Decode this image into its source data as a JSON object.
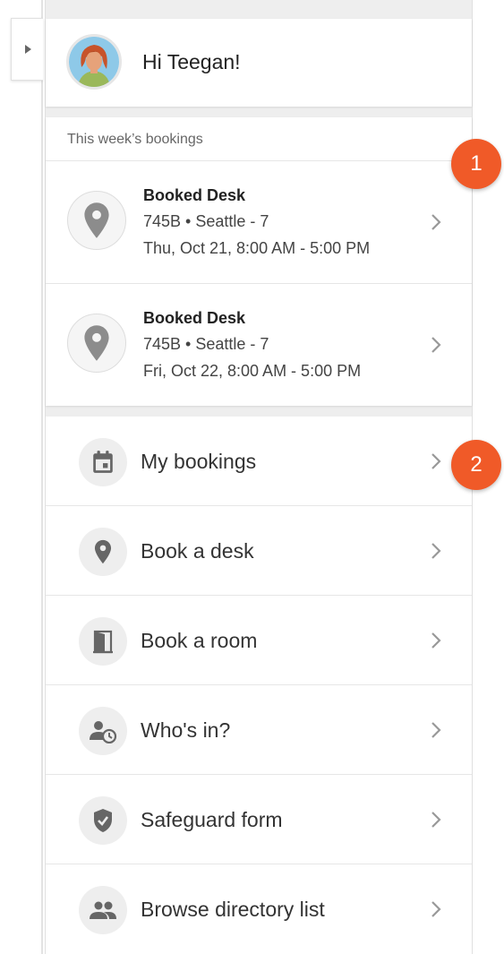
{
  "greeting": {
    "text": "Hi Teegan!"
  },
  "bookings": {
    "title": "This week’s bookings",
    "items": [
      {
        "title": "Booked Desk",
        "location": "745B • Seattle - 7",
        "time": "Thu, Oct 21, 8:00 AM - 5:00 PM",
        "icon": "location-pin-icon"
      },
      {
        "title": "Booked Desk",
        "location": "745B • Seattle - 7",
        "time": "Fri, Oct 22, 8:00 AM - 5:00 PM",
        "icon": "location-pin-icon"
      }
    ]
  },
  "menu": {
    "items": [
      {
        "label": "My bookings",
        "icon": "calendar-icon"
      },
      {
        "label": "Book a desk",
        "icon": "location-pin-icon"
      },
      {
        "label": "Book a room",
        "icon": "door-icon"
      },
      {
        "label": "Who's in?",
        "icon": "person-clock-icon"
      },
      {
        "label": "Safeguard form",
        "icon": "shield-check-icon"
      },
      {
        "label": "Browse directory list",
        "icon": "people-icon"
      }
    ]
  },
  "callouts": {
    "one": "1",
    "two": "2"
  },
  "colors": {
    "accent": "#f05a28",
    "icon_gray": "#666666",
    "chevron": "#999999"
  }
}
